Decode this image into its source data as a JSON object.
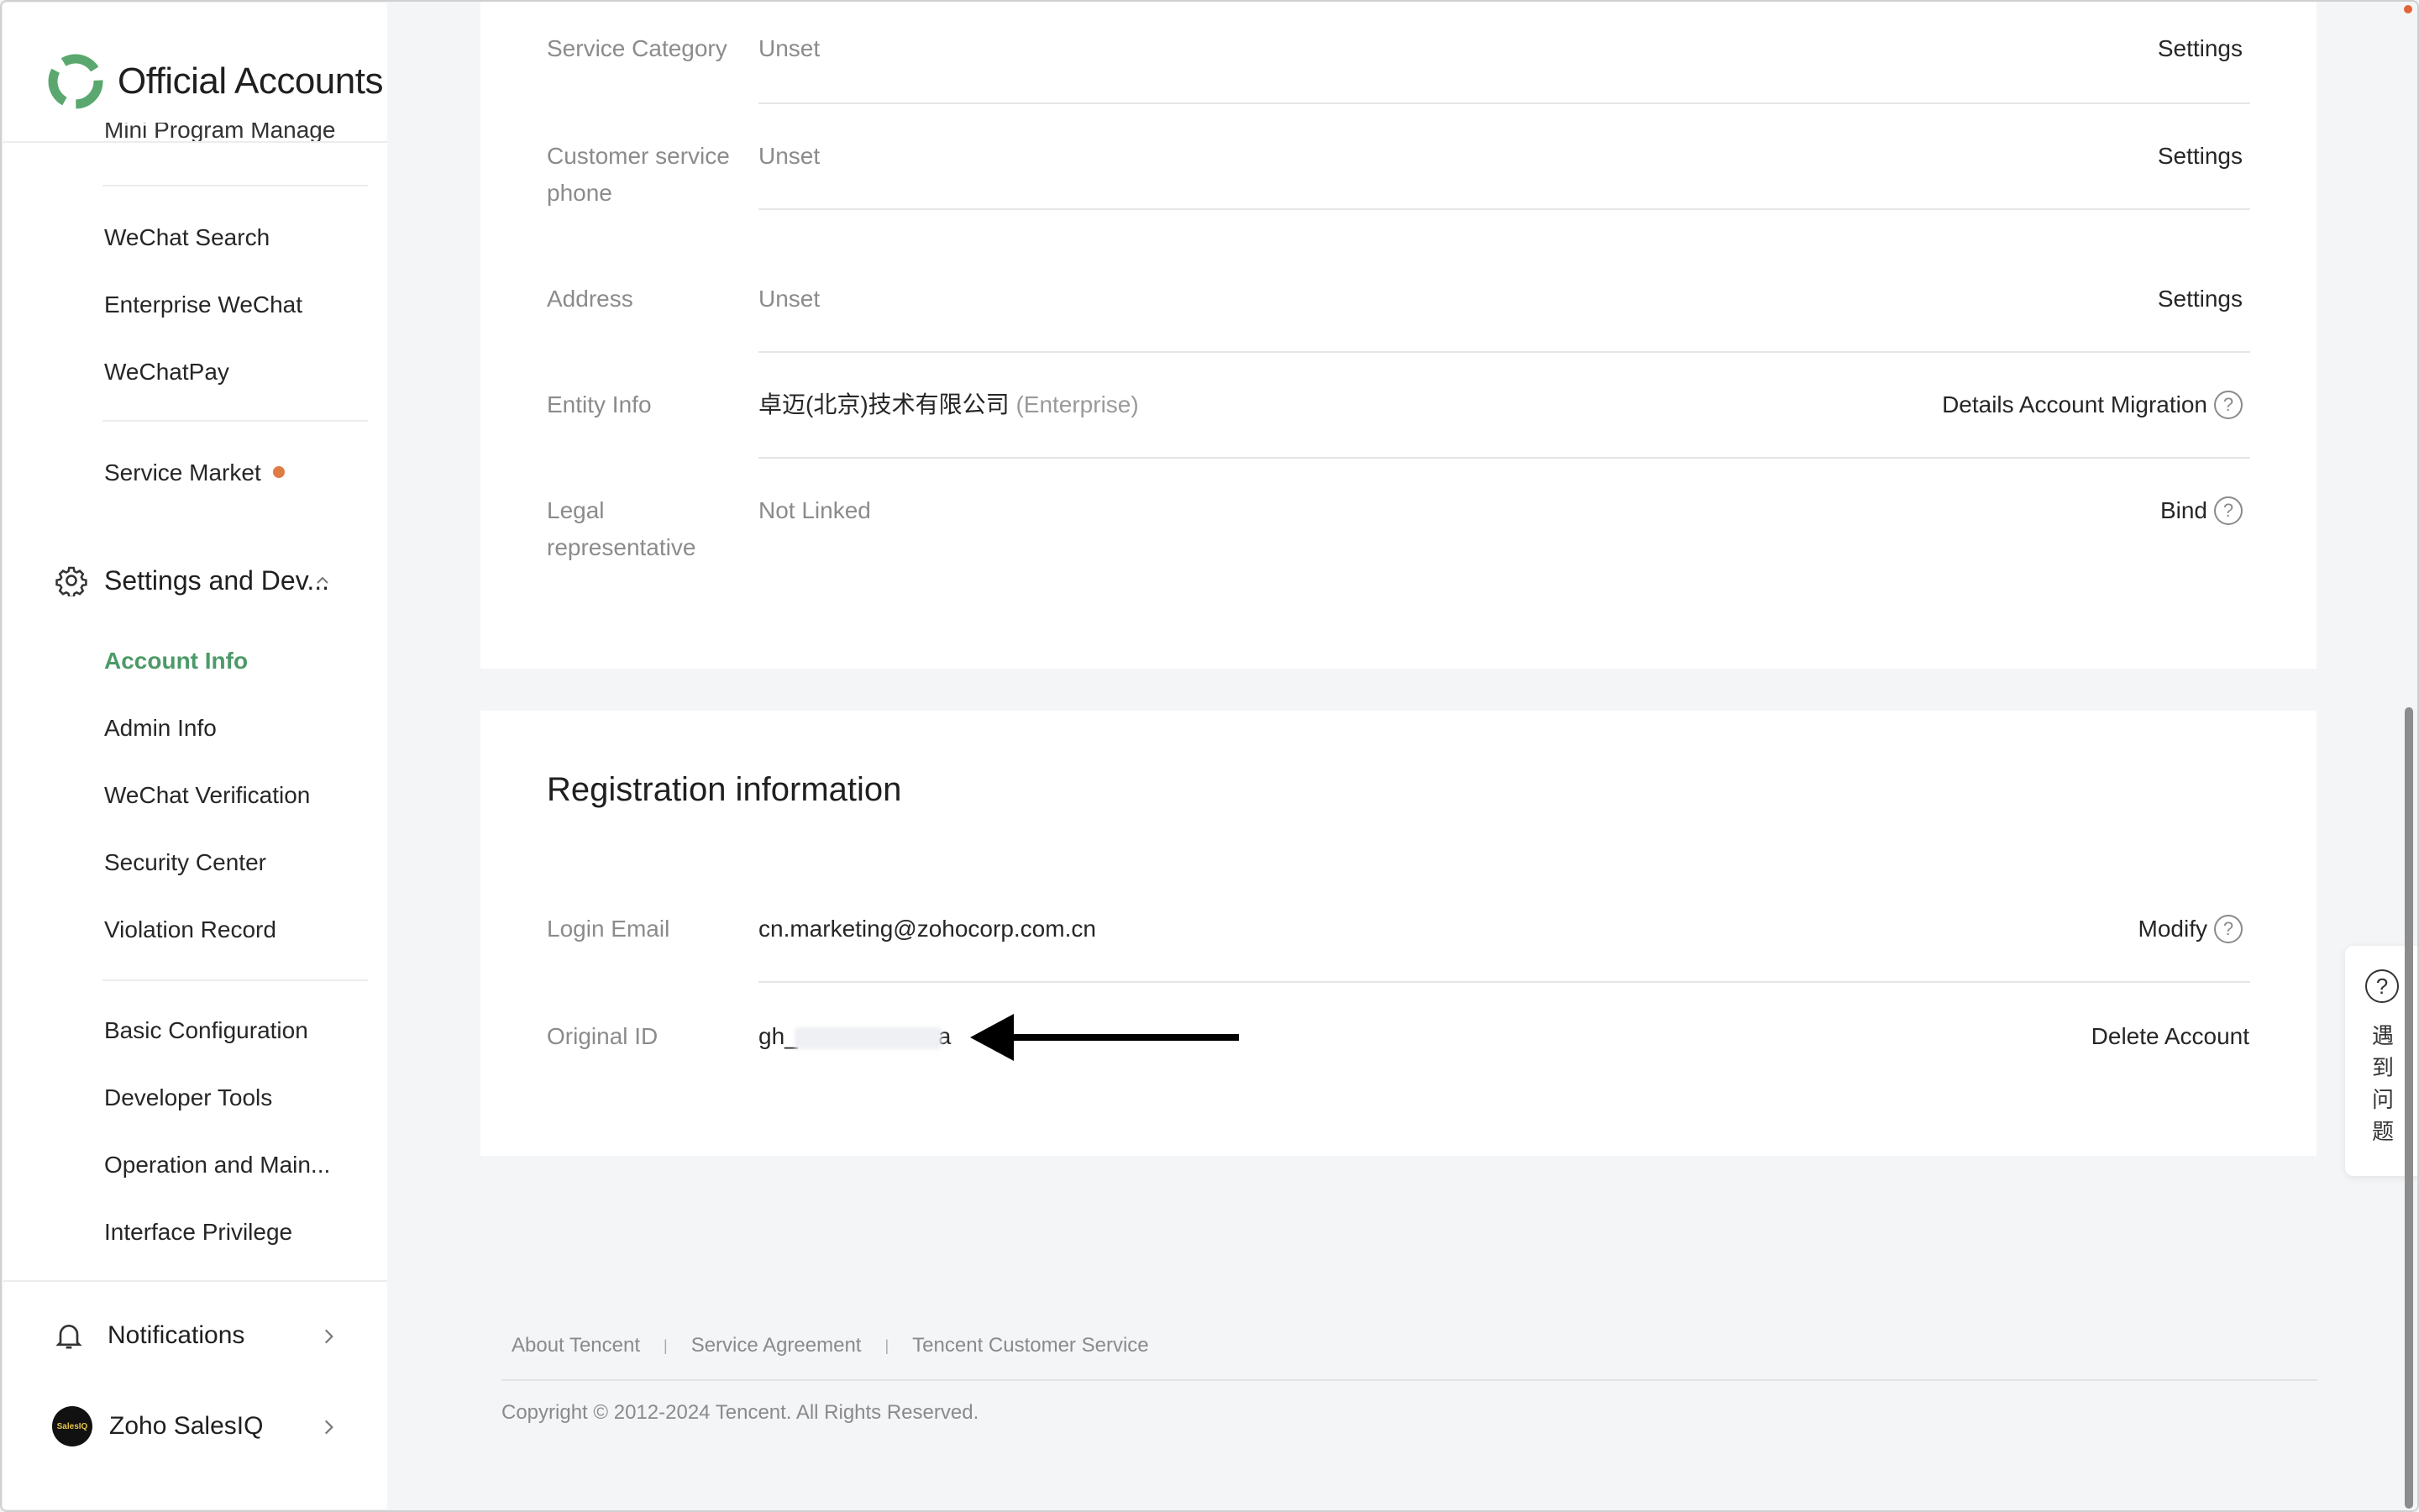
{
  "app": {
    "title": "Official Accounts"
  },
  "sidebar": {
    "cut_item": "Mini Program Manage",
    "group1": [
      "WeChat Search",
      "Enterprise WeChat",
      "WeChatPay"
    ],
    "service_market": "Service Market",
    "section_title": "Settings and Dev...",
    "settings_items": [
      "Account Info",
      "Admin Info",
      "WeChat Verification",
      "Security Center",
      "Violation Record"
    ],
    "dev_items": [
      "Basic Configuration",
      "Developer Tools",
      "Operation and Main...",
      "Interface Privilege"
    ],
    "notifications": "Notifications",
    "account_name": "Zoho SalesIQ",
    "account_avatar_text": "SalesIQ"
  },
  "account_card": {
    "rows": [
      {
        "label": "Service Category",
        "value": "Unset",
        "action": "Settings"
      },
      {
        "label": "Customer service phone",
        "value": "Unset",
        "action": "Settings"
      },
      {
        "label": "Address",
        "value": "Unset",
        "action": "Settings"
      },
      {
        "label": "Entity Info",
        "value": "卓迈(北京)技术有限公司",
        "value_suffix": "(Enterprise)",
        "action": "Details Account Migration"
      },
      {
        "label": "Legal representative",
        "value": "Not Linked",
        "action": "Bind"
      }
    ]
  },
  "registration": {
    "title": "Registration information",
    "login_email_label": "Login Email",
    "login_email_value": "cn.marketing@zohocorp.com.cn",
    "login_email_action": "Modify",
    "original_id_label": "Original ID",
    "original_id_prefix": "gh_",
    "original_id_suffix": "a",
    "original_id_action": "Delete Account"
  },
  "help": {
    "text": "遇到问题"
  },
  "footer": {
    "links": [
      "About Tencent",
      "Service Agreement",
      "Tencent Customer Service"
    ],
    "copyright": "Copyright © 2012-2024 Tencent. All Rights Reserved."
  },
  "colors": {
    "accent_green": "#4c9a68",
    "dot_orange": "#e07b44"
  }
}
